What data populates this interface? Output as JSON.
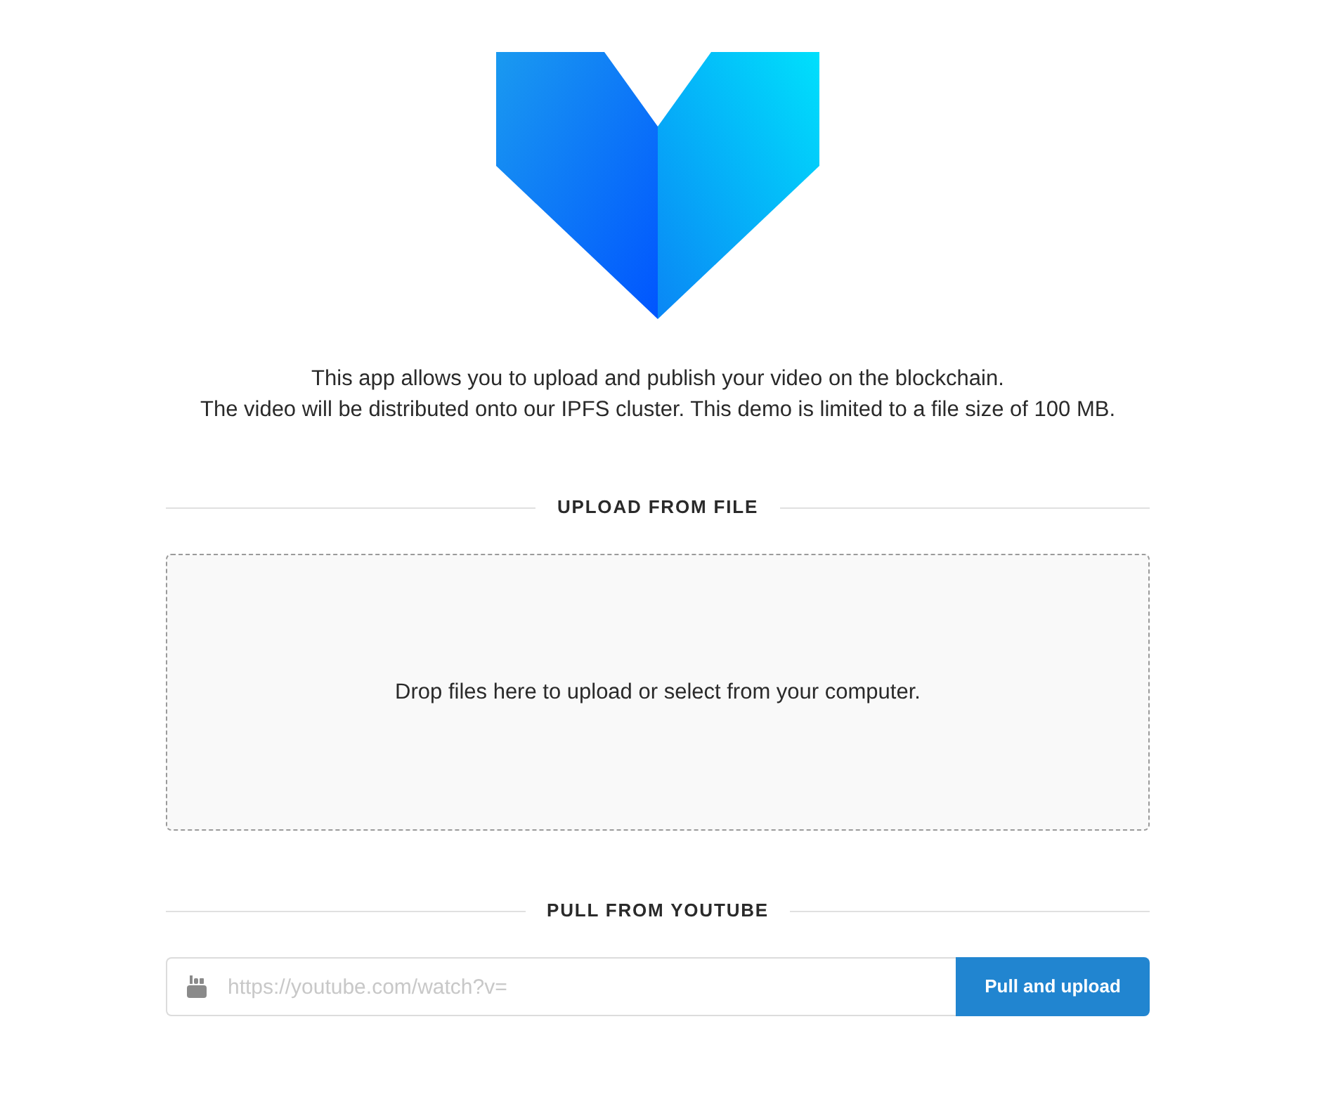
{
  "intro": [
    "This app allows you to upload and publish your video on the blockchain.",
    "The video will be distributed onto our IPFS cluster. This demo is limited to a file size of 100 MB."
  ],
  "upload_section": {
    "heading": "UPLOAD FROM FILE",
    "dropzone_text": "Drop files here to upload or select from your computer."
  },
  "youtube_section": {
    "heading": "PULL FROM YOUTUBE",
    "url_field": {
      "placeholder": "https://youtube.com/watch?v="
    },
    "button": "Pull and upload"
  }
}
